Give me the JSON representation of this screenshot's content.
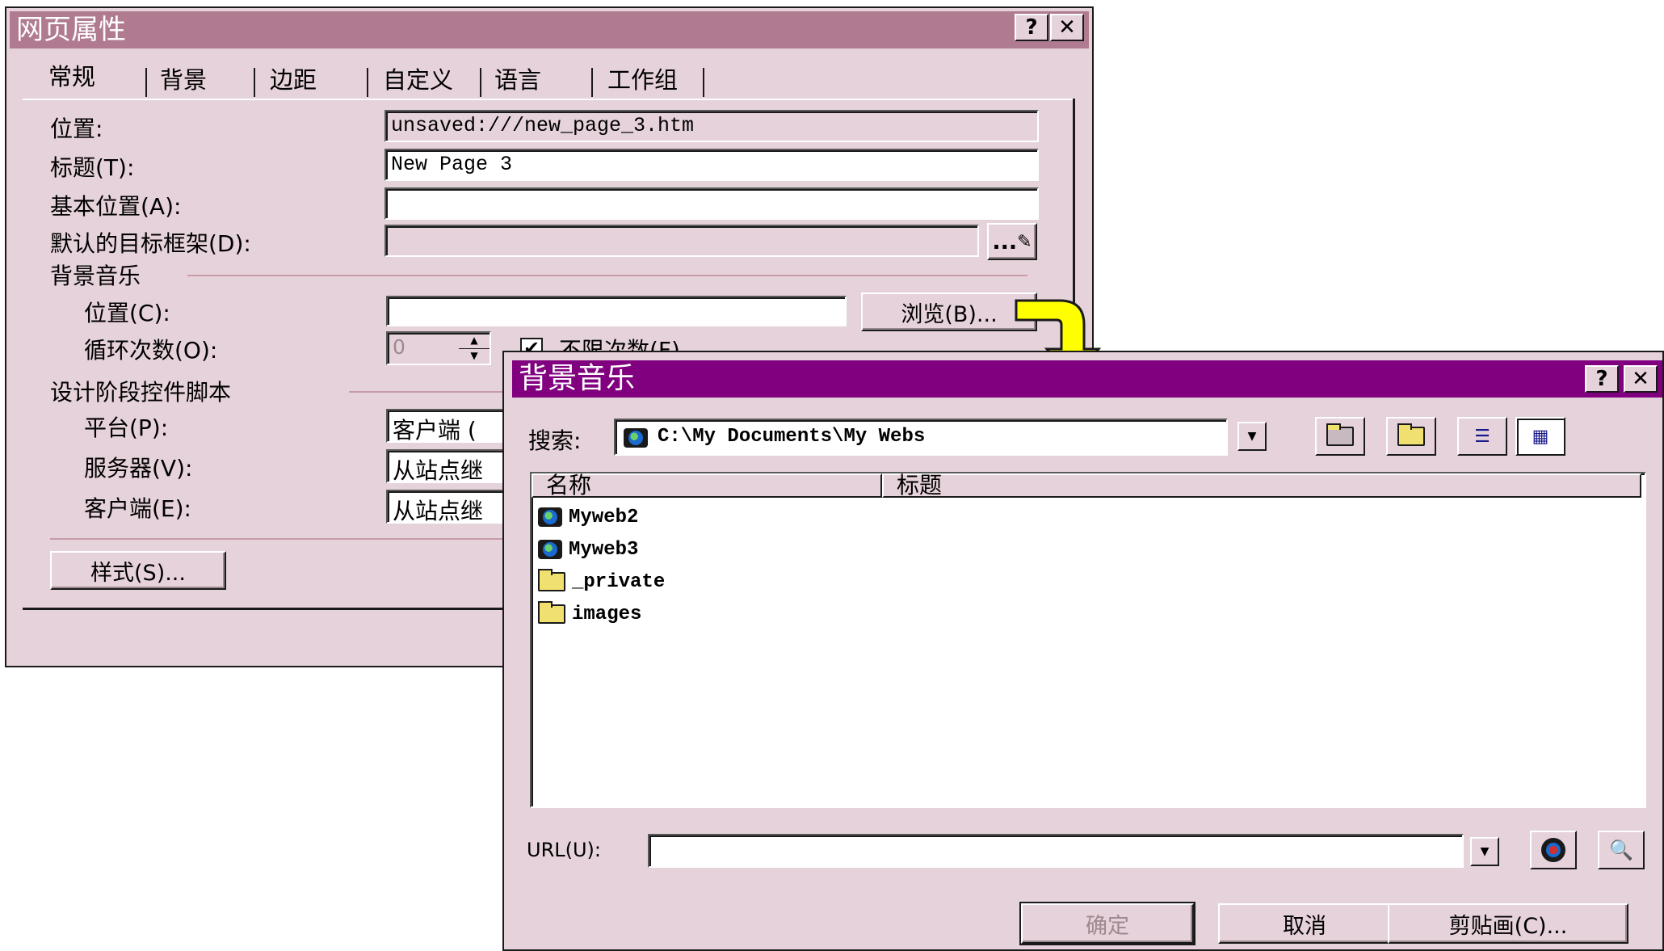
{
  "dialog1": {
    "title": "网页属性",
    "help_btn": "?",
    "close_btn": "✕",
    "tabs": [
      "常规",
      "背景",
      "边距",
      "自定义",
      "语言",
      "工作组"
    ],
    "fields": {
      "location_label": "位置:",
      "location_value": "unsaved:///new_page_3.htm",
      "title_label": "标题(T):",
      "title_value": "New Page 3",
      "base_label": "基本位置(A):",
      "base_value": "",
      "target_label": "默认的目标框架(D):",
      "target_value": "",
      "target_btn": "..."
    },
    "bg_music": {
      "section": "背景音乐",
      "location_label": "位置(C):",
      "location_value": "",
      "browse_btn": "浏览(B)...",
      "loop_label": "循环次数(O):",
      "loop_value": "0",
      "unlimited_label": "不限次数(F)",
      "unlimited_checked": true
    },
    "design": {
      "section": "设计阶段控件脚本",
      "platform_label": "平台(P):",
      "platform_value": "客户端 (",
      "server_label": "服务器(V):",
      "server_value": "从站点继",
      "client_label": "客户端(E):",
      "client_value": "从站点继"
    },
    "style_btn": "样式(S)..."
  },
  "dialog2": {
    "title": "背景音乐",
    "help_btn": "?",
    "close_btn": "✕",
    "search_label": "搜索:",
    "search_path": "C:\\My Documents\\My Webs",
    "columns": [
      "名称",
      "标题"
    ],
    "items": [
      {
        "name": "Myweb2",
        "icon": "web-folder-icon"
      },
      {
        "name": "Myweb3",
        "icon": "web-folder-icon"
      },
      {
        "name": "_private",
        "icon": "folder-icon"
      },
      {
        "name": "images",
        "icon": "folder-icon"
      }
    ],
    "url_label": "URL(U):",
    "url_value": "",
    "ok_btn": "确定",
    "cancel_btn": "取消",
    "clipart_btn": "剪贴画(C)..."
  },
  "arrow_color": "#ffff00"
}
